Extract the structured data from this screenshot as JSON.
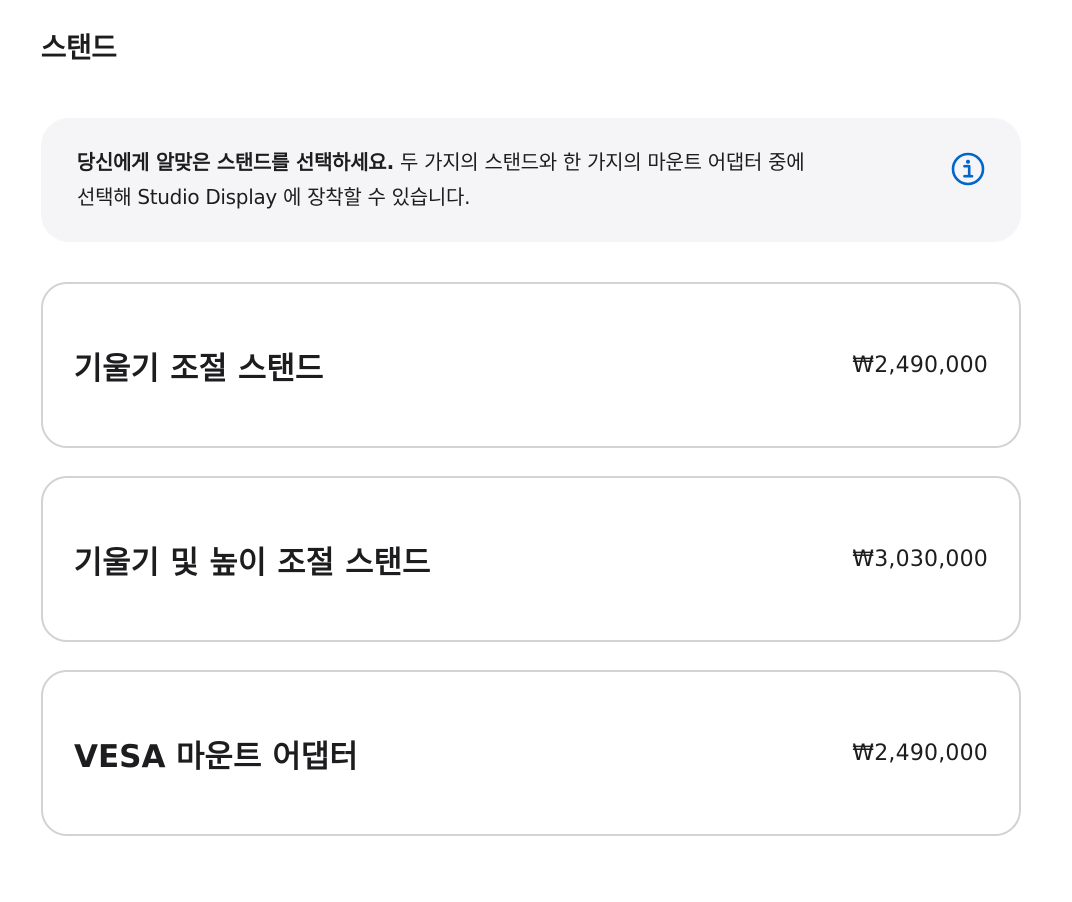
{
  "section": {
    "title": "스탠드"
  },
  "info": {
    "bold_text": "당신에게 알맞은 스탠드를 선택하세요.",
    "line1_rest": " 두 가지의 스탠드와 한 가지의 마운트 어댑터 중에",
    "line2": "선택해 Studio Display 에 장착할 수 있습니다.",
    "icon": "info-circle-icon",
    "icon_color": "#0066cc"
  },
  "options": [
    {
      "name": "기울기 조절 스탠드",
      "price": "₩2,490,000"
    },
    {
      "name": "기울기 및 높이 조절 스탠드",
      "price": "₩3,030,000"
    },
    {
      "name": "VESA 마운트 어댑터",
      "price": "₩2,490,000"
    }
  ],
  "colors": {
    "text": "#1d1d1f",
    "info_bg": "#f5f5f7",
    "card_border": "#d2d2d7"
  }
}
